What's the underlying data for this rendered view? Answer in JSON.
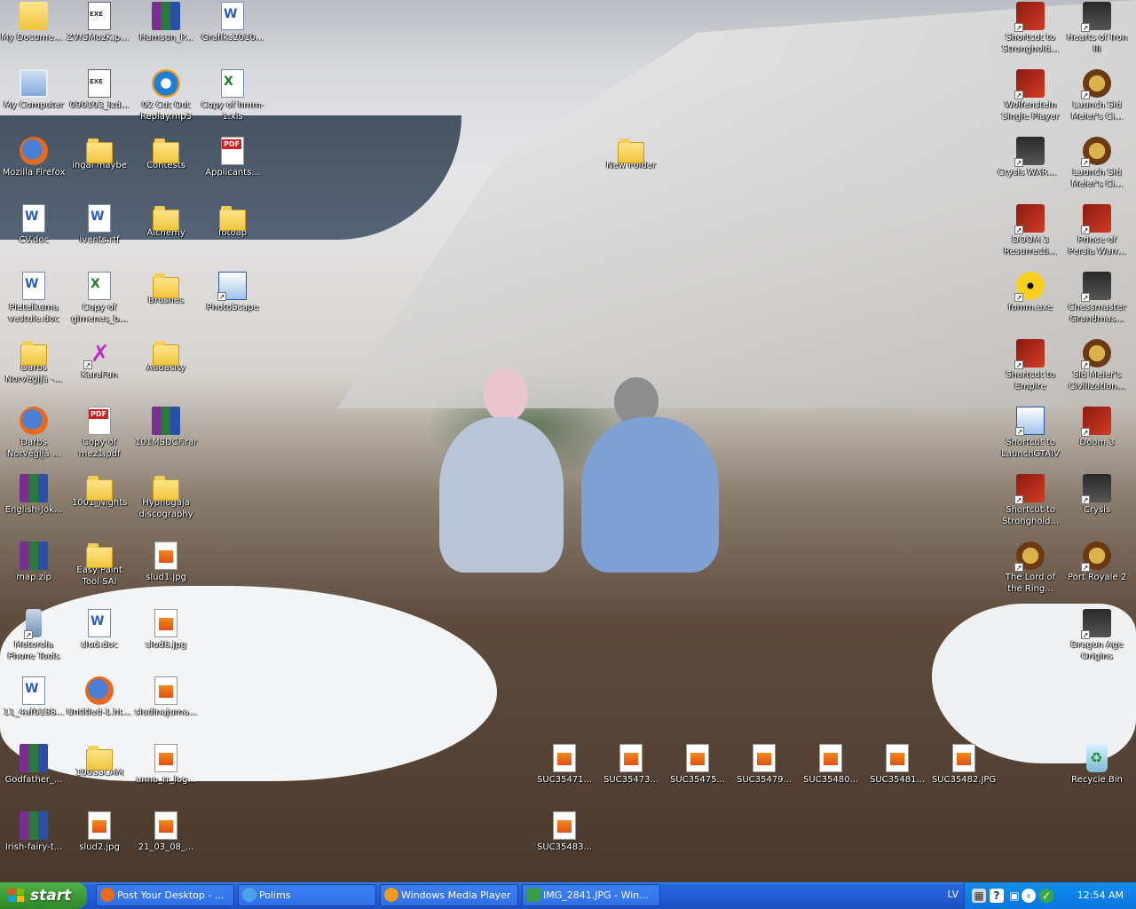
{
  "desktop": {
    "icons_left": [
      {
        "label": "My Documents",
        "type": "mydocs"
      },
      {
        "label": "ZVrSMozK.part",
        "type": "exe"
      },
      {
        "label": "Hamsun_P...",
        "type": "rar"
      },
      {
        "label": "Grafiks2010...",
        "type": "doc"
      },
      {
        "label": "My Computer",
        "type": "comp"
      },
      {
        "label": "090103_Izd...",
        "type": "exe"
      },
      {
        "label": "02 Cut Out Replay.mp3",
        "type": "mp3"
      },
      {
        "label": "Copy of hmm-1.xls",
        "type": "xls"
      },
      {
        "label": "Mozilla Firefox",
        "type": "ff"
      },
      {
        "label": "ingai maybe",
        "type": "folder"
      },
      {
        "label": "Contests",
        "type": "folder"
      },
      {
        "label": "Applicants...",
        "type": "pdf"
      },
      {
        "label": "CV.doc",
        "type": "doc"
      },
      {
        "label": "ivents.rtf",
        "type": "doc"
      },
      {
        "label": "Alchemy",
        "type": "folder"
      },
      {
        "label": "fotoap",
        "type": "folder"
      },
      {
        "label": "Pieteikuma vestule.doc",
        "type": "doc"
      },
      {
        "label": "Copy of gimenes_b...",
        "type": "xls"
      },
      {
        "label": "Brushes",
        "type": "folder"
      },
      {
        "label": "PhotoScape",
        "type": "app"
      },
      {
        "label": "Darbs Norvēģijā -...",
        "type": "folder"
      },
      {
        "label": "KaraFun",
        "type": "karafun"
      },
      {
        "label": "Audacity",
        "type": "folder"
      },
      {
        "label": "Darbs Norvēģijā ...",
        "type": "ff"
      },
      {
        "label": "Copy of mez1.pdf",
        "type": "pdf"
      },
      {
        "label": "101MSDCF.rar",
        "type": "rar"
      },
      {
        "label": "English-Jok...",
        "type": "rar"
      },
      {
        "label": "1001_Nights",
        "type": "folder"
      },
      {
        "label": "Hypnogaja discography",
        "type": "folder"
      },
      {
        "label": "map.zip",
        "type": "rar"
      },
      {
        "label": "Easy Paint Tool SAI",
        "type": "folder"
      },
      {
        "label": "slud1.jpg",
        "type": "jpg"
      },
      {
        "label": "Motorola Phone Tools",
        "type": "phone"
      },
      {
        "label": "slud.doc",
        "type": "doc"
      },
      {
        "label": "slud8.jpg",
        "type": "jpg"
      },
      {
        "label": "11_4af0188...",
        "type": "doc"
      },
      {
        "label": "Untitled-1.html",
        "type": "ff"
      },
      {
        "label": "sludinajuma...",
        "type": "jpg"
      },
      {
        "label": "Godfather_...",
        "type": "rar"
      },
      {
        "label": "100SSCAM",
        "type": "folder"
      },
      {
        "label": "anno_rr_log...",
        "type": "jpg"
      },
      {
        "label": "Irish-fairy-t...",
        "type": "rar"
      },
      {
        "label": "slud2.jpg",
        "type": "jpg"
      },
      {
        "label": "21_03_08_...",
        "type": "jpg"
      }
    ],
    "icons_middle": [
      {
        "label": "New Folder",
        "type": "folder"
      },
      {
        "label": "SUC35471...",
        "type": "jpg"
      },
      {
        "label": "SUC35473...",
        "type": "jpg"
      },
      {
        "label": "SUC35475...",
        "type": "jpg"
      },
      {
        "label": "SUC35479...",
        "type": "jpg"
      },
      {
        "label": "SUC35480...",
        "type": "jpg"
      },
      {
        "label": "SUC35481...",
        "type": "jpg"
      },
      {
        "label": "SUC35482.JPG",
        "type": "jpg"
      },
      {
        "label": "SUC35483...",
        "type": "jpg"
      }
    ],
    "icons_right": [
      {
        "label": "Shortcut to Stronghold...",
        "type": "game"
      },
      {
        "label": "Hearts of Iron III",
        "type": "game3"
      },
      {
        "label": "Wolfenstein Single Player",
        "type": "game"
      },
      {
        "label": "Launch Sid Meier's Ci...",
        "type": "game2"
      },
      {
        "label": "Crysis WARHEAD",
        "type": "game3"
      },
      {
        "label": "Launch Sid Meier's Ci...",
        "type": "game2"
      },
      {
        "label": "DOOM 3 Resurrecti...",
        "type": "game"
      },
      {
        "label": "Prince of Persia Warr...",
        "type": "game"
      },
      {
        "label": "fomm.exe",
        "type": "nuke"
      },
      {
        "label": "Chessmaster Grandmas...",
        "type": "game3"
      },
      {
        "label": "Shortcut to Empire",
        "type": "game"
      },
      {
        "label": "Sid Meier's Civilization...",
        "type": "game2"
      },
      {
        "label": "Shortcut to LaunchGTAIV",
        "type": "app"
      },
      {
        "label": "Doom 3",
        "type": "game"
      },
      {
        "label": "Shortcut to Stronghold...",
        "type": "game"
      },
      {
        "label": "Crysis",
        "type": "game3"
      },
      {
        "label": "The Lord of the Ring...",
        "type": "game2"
      },
      {
        "label": "Port Royale 2",
        "type": "game2"
      },
      {
        "label": "Dragon Age Origins",
        "type": "game3"
      },
      {
        "label": "Recycle Bin",
        "type": "bin"
      }
    ]
  },
  "taskbar": {
    "start_label": "start",
    "tasks": [
      {
        "label": "Post Your Desktop - ...",
        "icon": "firefox-icon",
        "color": "#e86a1a"
      },
      {
        "label": "Polims",
        "icon": "chat-icon",
        "color": "#4aa3e8"
      },
      {
        "label": "Windows Media Player",
        "icon": "media-player-icon",
        "color": "#f29a1a"
      },
      {
        "label": "IMG_2841.JPG - Win...",
        "icon": "image-viewer-icon",
        "color": "#3a9a4a"
      }
    ],
    "tray": {
      "language": "LV",
      "clock": "12:54 AM",
      "help_glyph": "?"
    }
  }
}
